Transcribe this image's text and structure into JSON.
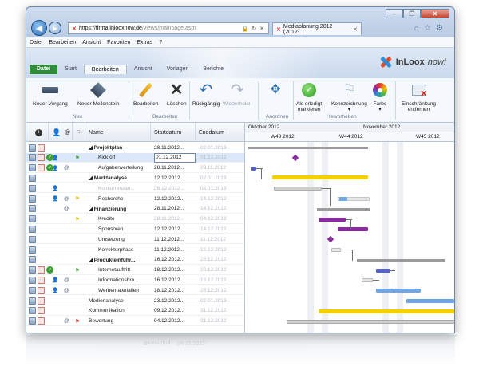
{
  "browser": {
    "url_scheme": "https://",
    "url_host": "firma.inlooxnow.de",
    "url_path": "/views/mainpage.aspx",
    "tab_title": "Mediaplanung 2012 (2012-...",
    "window_controls": [
      "–",
      "❐",
      "✕"
    ]
  },
  "menu": [
    "Datei",
    "Bearbeiten",
    "Ansicht",
    "Favoriten",
    "Extras",
    "?"
  ],
  "ribbon_tabs": [
    "Datei",
    "Start",
    "Bearbeiten",
    "Ansicht",
    "Vorlagen",
    "Berichte"
  ],
  "active_ribbon_tab": "Bearbeiten",
  "logo": {
    "brand": "InLoox",
    "suffix": " now!"
  },
  "ribbon": {
    "neuer_vorgang": "Neuer Vorgang",
    "neuer_meilenstein": "Neuer Meilenstein",
    "group_neu": "Neu",
    "bearbeiten": "Bearbeiten",
    "loeschen": "Löschen",
    "group_bearbeiten": "Bearbeiten",
    "rueckgaengig": "Rückgängig",
    "wiederholen": "Wiederholen",
    "group_anordnen": "Anordnen",
    "als_erledigt_1": "Als erledigt",
    "als_erledigt_2": "markieren",
    "kennzeichnung": "Kennzeichnung",
    "farbe": "Farbe",
    "group_hervorheben": "Hervorheben",
    "einschraenkung_1": "Einschränkung",
    "einschraenkung_2": "entfernen"
  },
  "grid": {
    "headers": {
      "name": "Name",
      "start": "Startdatum",
      "end": "Enddatum"
    },
    "rows": [
      {
        "name": "◢ Projektplan",
        "start": "28.11.2012...",
        "end": "02.01.2013",
        "bold": true
      },
      {
        "name": "Kick off",
        "start": "01.12.2012",
        "end": "01.12.2012",
        "selected": true
      },
      {
        "name": "Aufgabenverteilung",
        "start": "28.11.2012...",
        "end": "29.11.2012"
      },
      {
        "name": "◢ Marktanalyse",
        "start": "12.12.2012...",
        "end": "02.01.2013",
        "bold": true
      },
      {
        "name": "Konkurrenzan...",
        "start": "26.12.2012...",
        "end": "02.01.2013",
        "dim": true
      },
      {
        "name": "Recherche",
        "start": "12.12.2012...",
        "end": "14.12.2012"
      },
      {
        "name": "◢ Finanzierung",
        "start": "28.11.2012...",
        "end": "14.12.2012",
        "bold": true
      },
      {
        "name": "Kredite",
        "start": "28.11.2012...",
        "end": "04.12.2012",
        "dim_start": true
      },
      {
        "name": "Sponsoren",
        "start": "12.12.2012...",
        "end": "14.12.2012"
      },
      {
        "name": "Umsetzung",
        "start": "11.12.2012...",
        "end": "11.12.2012"
      },
      {
        "name": "Korrekturphase",
        "start": "11.12.2012...",
        "end": "12.12.2012"
      },
      {
        "name": "◢ Produkteinführ...",
        "start": "16.12.2012...",
        "end": "25.12.2012",
        "bold": true
      },
      {
        "name": "Internetauftritt",
        "start": "18.12.2012...",
        "end": "20.12.2012"
      },
      {
        "name": "Informationsbro...",
        "start": "16.12.2012...",
        "end": "18.12.2012"
      },
      {
        "name": "Werbematerialien",
        "start": "18.12.2012...",
        "end": "25.12.2012"
      },
      {
        "name": "Medienanalyse",
        "start": "23.12.2012...",
        "end": "02.01.2013"
      },
      {
        "name": "Kommunikation",
        "start": "09.12.2012...",
        "end": "31.12.2012"
      },
      {
        "name": "Bewertung",
        "start": "04.12.2012...",
        "end": "31.12.2012"
      }
    ]
  },
  "gantt": {
    "months": [
      "Oktober 2012",
      "November 2012"
    ],
    "weeks": [
      "W43 2012",
      "W44 2012",
      "W45 2012"
    ]
  },
  "colors": {
    "accent_green": "#2f8d3c",
    "yellow": "#f5d000",
    "purple": "#8a2aa0",
    "blue_light": "#6ea7e6",
    "blue_dark": "#5561c4"
  },
  "reflection_text": [
    "Bewertung",
    "04.12.2012..."
  ]
}
